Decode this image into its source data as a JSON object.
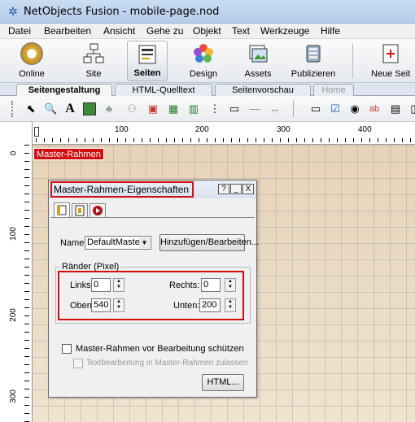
{
  "app": {
    "title": "NetObjects Fusion - mobile-page.nod"
  },
  "menu": [
    "Datei",
    "Bearbeiten",
    "Ansicht",
    "Gehe zu",
    "Objekt",
    "Text",
    "Werkzeuge",
    "Hilfe"
  ],
  "toolbar": {
    "buttons": [
      {
        "label": "Online",
        "icon": "online-icon"
      },
      {
        "label": "Site",
        "icon": "sitemap-icon"
      },
      {
        "label": "Seiten",
        "icon": "pages-icon",
        "active": true
      },
      {
        "label": "Design",
        "icon": "design-icon"
      },
      {
        "label": "Assets",
        "icon": "assets-icon"
      },
      {
        "label": "Publizieren",
        "icon": "publish-icon"
      },
      {
        "label": "Neue Seit",
        "icon": "new-page-icon"
      }
    ]
  },
  "tabs": [
    "Seitengestaltung",
    "HTML-Quelltext",
    "Seitenvorschau",
    "Home"
  ],
  "ruler": {
    "top": [
      "100",
      "200",
      "300",
      "400"
    ],
    "left": [
      "0",
      "100",
      "200",
      "300"
    ]
  },
  "canvas": {
    "master_label": "Master-Rahmen"
  },
  "dialog": {
    "title": "Master-Rahmen-Eigenschaften",
    "help": "?",
    "minimize": "_",
    "close": "X",
    "name_label": "Name:",
    "name_value": "DefaultMasterI",
    "add_edit_button": "Hinzufügen/Bearbeiten...",
    "margins_group": "Ränder (Pixel)",
    "links_label": "Links:",
    "links_value": "0",
    "rechts_label": "Rechts:",
    "rechts_value": "0",
    "oben_label": "Oben:",
    "oben_value": "540",
    "unten_label": "Unten:",
    "unten_value": "200",
    "protect_label": "Master-Rahmen vor Bearbeitung schützen",
    "text_edit_label": "Textbearbeitung in Master-Rahmen zulassen",
    "html_button": "HTML..."
  },
  "colors": {
    "accent_red": "#d10d0d",
    "canvas_bg": "#e9dac3"
  }
}
